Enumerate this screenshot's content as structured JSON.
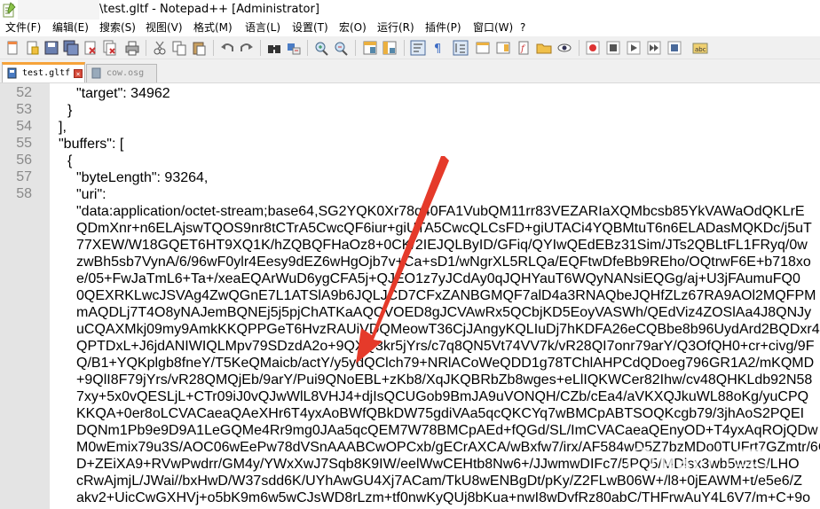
{
  "window": {
    "title": "\\test.gltf - Notepad++ [Administrator]"
  },
  "menu": [
    {
      "label": "文件(F)"
    },
    {
      "label": "编辑(E)"
    },
    {
      "label": "搜索(S)"
    },
    {
      "label": "视图(V)"
    },
    {
      "label": "格式(M)"
    },
    {
      "label": "语言(L)"
    },
    {
      "label": "设置(T)"
    },
    {
      "label": "宏(O)"
    },
    {
      "label": "运行(R)"
    },
    {
      "label": "插件(P)"
    },
    {
      "label": "窗口(W)"
    },
    {
      "label": "?"
    }
  ],
  "toolbar_icons": [
    "new-file-icon",
    "open-file-icon",
    "save-icon",
    "save-all-icon",
    "close-icon",
    "close-all-icon",
    "print-icon",
    "cut-icon",
    "copy-icon",
    "paste-icon",
    "undo-icon",
    "redo-icon",
    "find-icon",
    "replace-icon",
    "zoom-in-icon",
    "zoom-out-icon",
    "sync-vertical-icon",
    "sync-horizontal-icon",
    "word-wrap-icon",
    "all-chars-icon",
    "indent-guide-icon",
    "user-lang-icon",
    "doc-map-icon",
    "function-list-icon",
    "folder-workspace-icon",
    "monitoring-icon",
    "record-macro-icon",
    "stop-record-icon",
    "play-macro-icon",
    "run-multiple-icon",
    "save-macro-icon",
    "spell-check-icon"
  ],
  "tabs": [
    {
      "label": "test.gltf",
      "active": true
    },
    {
      "label": "cow.osg",
      "active": false
    }
  ],
  "editor": {
    "line_numbers": [
      "52",
      "53",
      "54",
      "55",
      "56",
      "57",
      "58"
    ],
    "lines": [
      "\"target\": 34962",
      "}",
      "],",
      "\"buffers\": [",
      "{",
      "\"byteLength\": 93264,",
      "\"uri\":",
      "\"data:application/octet-stream;base64,SG2YQK0Xr78q40FA1VubQM11rr83VEZARIaXQMbcsb85YkVAWaOdQKLrE",
      "QDmXnr+n6ELAjswTQOS9nr8tCTrA5CwcQF6iur+giUTA5CwcQLCsFD+giUTACi4YQBMtuT6n6ELADasMQKDc/j5uT",
      "77XEW/W18GQET6HT9XQ1K/hZQBQFHaOz8+0CK/2IEJQLByID/GFiq/QYIwQEdEBz31Sim/JTs2QBLtFL1FRyq/0w",
      "zwBh5sb7VynA/6/96wF0ylr4Eesy9dEZ6wHgOjb7v+Ca+sD1/wNgrXL5RLQa/EQFtwDfeBb9REho/OQtrwF6E+b718xo",
      "e/05+FwJaTmL6+Ta+/xeaEQArWuD6ygCFA5j+QJEO1z7yJCdAy0qJQHYauT6WQyNANsiEQGg/aj+U3jFAumuFQ0",
      "0QEXRKLwcJSVAg4ZwQGnE7L1ATSlA9b6JQLJCD7CFxZANBGMQF7alD4a3RNAQbeJQHfZLz67RA9AOl2MQFPM",
      "mAQDLj7T4O8yNAJemBQNEj5j5pjChATKaAQCVOED8gJCVAwRx5QCbjKD5EoyVASWh/QEdViz4ZOSlAa4J8QNJy",
      "uCQAXMkj09my9AmkKKQPPGeT6HvzRAUiVDQMeowT36CjJAngyKQLIuDj7hKDFA26eCQBbe8b96UydArd2BQDxr4",
      "QPTDxL+J6jdANIWIQLMpv79SDzdA2o+9QXQ3kr5jYrs/c7q8QN5Vt74VV7k/vR28QI7onr79arY/Q3OfQH0+cr+civg/9F",
      "Q/B1+YQKplgb8fneY/T5KeQMaicb/actY/y5ydQClch79+NRlACoWeQDD1g78TChlAHPCdQDoeg796GR1A2/mKQMD",
      "+9QlI8F79jYrs/vR28QMQjEb/9arY/Pui9QNoEBL+zKb8/XqJKQBRbZb8wges+eLlIQKWCer82Ihw/cv48QHKLdb92N58",
      "7xy+5x0vQESLjL+CTr09iJ0vQJwWlL8VHJ4+djIsQCUGob9BmJA9uVONQH/CZb/cEa4/aVKXQJkuWL88oKg/yuCPQ",
      "KKQA+0er8oLCVACaeaQAeXHr6T4yxAoBWfQBkDW75gdiVAa5qcQKCYq7wBMCpABTSOQKcgb79/3jhAoS2PQEI",
      "DQNm1Pb9e9D9A1LeGQMe4Rr9mg0JAa5qcQEM7W78BMCpAEd+fQGd/SL/ImCVACaeaQEnyOD+T4yxAqROjQDw",
      "M0wEmix79u3S/AOC06wEePw78dVSnAAABCwOPCxb/gECrAXCA/wBxfw7/irx/AF584wD5Z7bzMDo0TUFrt7GZmtr/6C",
      "D+ZEiXA9+RVwPwdrr/GM4y/YWxXwJ7Sqb8K9IW/eelWwCEHtb8Nw6+/JJwmwDIFc7/5PQ5/MDisx3wb5wztS/LHO",
      "cRwAjmjL/JWai//bxHwD/W37sdd6K/UYhAwGU4Xj7ACam/TkU8wENBgDt/pKy/Z2FLwB06W+/l8+0jEAWM+t/e5e6/Z",
      "akv2+UicCwGXHVj+o5bK9m6w5wCJsWD8rLzm+tf0nwKyQUj8bKua+nwI8wDvfRz80abC/THFrwAuY4L6V7/m+C+9o"
    ]
  },
  "annotation": {
    "arrow_color": "#e53a2a"
  }
}
